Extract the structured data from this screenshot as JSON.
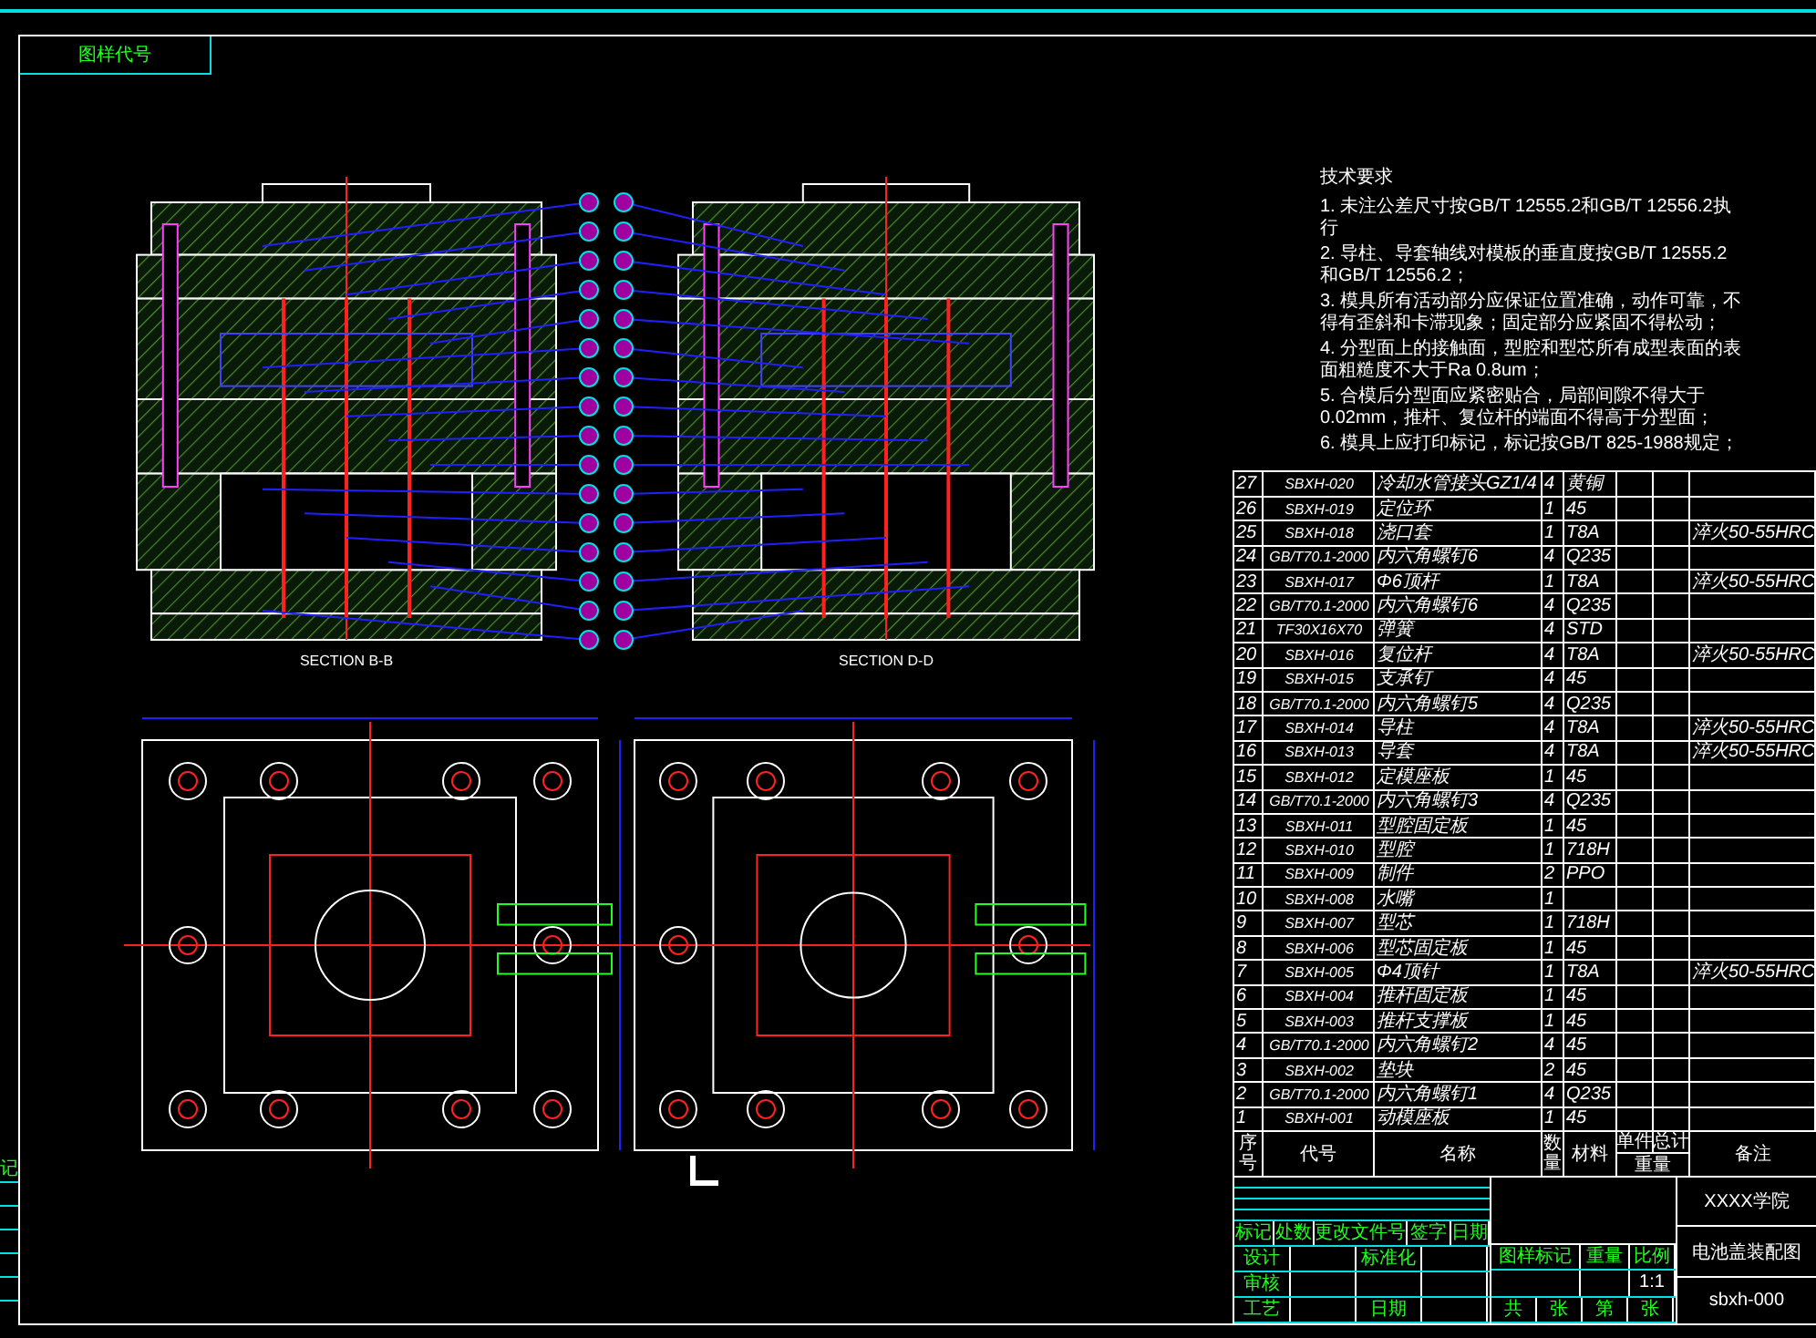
{
  "title_box": {
    "label": "图样代号"
  },
  "side_strip": {
    "label": "记"
  },
  "views": [
    {
      "kind": "section",
      "label": "SECTION B-B"
    },
    {
      "kind": "section",
      "label": "SECTION D-D"
    },
    {
      "kind": "plan"
    },
    {
      "kind": "plan"
    }
  ],
  "notes": {
    "heading": "技术要求",
    "items": [
      "1. 未注公差尺寸按GB/T 12555.2和GB/T 12556.2执行",
      "2. 导柱、导套轴线对模板的垂直度按GB/T 12555.2和GB/T 12556.2；",
      "3. 模具所有活动部分应保证位置准确，动作可靠，不得有歪斜和卡滞现象；固定部分应紧固不得松动；",
      "4. 分型面上的接触面，型腔和型芯所有成型表面的表面粗糙度不大于Ra 0.8um；",
      "5. 合模后分型面应紧密贴合，局部间隙不得大于0.02mm，推杆、复位杆的端面不得高于分型面；",
      "6. 模具上应打印标记，标记按GB/T 825-1988规定；"
    ]
  },
  "parts_table": {
    "rows": [
      {
        "no": "27",
        "code": "SBXH-020",
        "name": "冷却水管接头GZ1/4",
        "qty": "4",
        "material": "黄铜"
      },
      {
        "no": "26",
        "code": "SBXH-019",
        "name": "定位环",
        "qty": "1",
        "material": "45"
      },
      {
        "no": "25",
        "code": "SBXH-018",
        "name": "浇口套",
        "qty": "1",
        "material": "T8A",
        "note": "淬火50-55HRC"
      },
      {
        "no": "24",
        "code": "GB/T70.1-2000",
        "name": "内六角螺钉6",
        "qty": "4",
        "material": "Q235"
      },
      {
        "no": "23",
        "code": "SBXH-017",
        "name": "Φ6顶杆",
        "qty": "1",
        "material": "T8A",
        "note": "淬火50-55HRC"
      },
      {
        "no": "22",
        "code": "GB/T70.1-2000",
        "name": "内六角螺钉6",
        "qty": "4",
        "material": "Q235"
      },
      {
        "no": "21",
        "code": "TF30X16X70",
        "name": "弹簧",
        "qty": "4",
        "material": "STD"
      },
      {
        "no": "20",
        "code": "SBXH-016",
        "name": "复位杆",
        "qty": "4",
        "material": "T8A",
        "note": "淬火50-55HRC"
      },
      {
        "no": "19",
        "code": "SBXH-015",
        "name": "支承钉",
        "qty": "4",
        "material": "45"
      },
      {
        "no": "18",
        "code": "GB/T70.1-2000",
        "name": "内六角螺钉5",
        "qty": "4",
        "material": "Q235"
      },
      {
        "no": "17",
        "code": "SBXH-014",
        "name": "导柱",
        "qty": "4",
        "material": "T8A",
        "note": "淬火50-55HRC"
      },
      {
        "no": "16",
        "code": "SBXH-013",
        "name": "导套",
        "qty": "4",
        "material": "T8A",
        "note": "淬火50-55HRC"
      },
      {
        "no": "15",
        "code": "SBXH-012",
        "name": "定模座板",
        "qty": "1",
        "material": "45"
      },
      {
        "no": "14",
        "code": "GB/T70.1-2000",
        "name": "内六角螺钉3",
        "qty": "4",
        "material": "Q235"
      },
      {
        "no": "13",
        "code": "SBXH-011",
        "name": "型腔固定板",
        "qty": "1",
        "material": "45"
      },
      {
        "no": "12",
        "code": "SBXH-010",
        "name": "型腔",
        "qty": "1",
        "material": "718H"
      },
      {
        "no": "11",
        "code": "SBXH-009",
        "name": "制件",
        "qty": "2",
        "material": "PPO"
      },
      {
        "no": "10",
        "code": "SBXH-008",
        "name": "水嘴",
        "qty": "1"
      },
      {
        "no": "9",
        "code": "SBXH-007",
        "name": "型芯",
        "qty": "1",
        "material": "718H"
      },
      {
        "no": "8",
        "code": "SBXH-006",
        "name": "型芯固定板",
        "qty": "1",
        "material": "45"
      },
      {
        "no": "7",
        "code": "SBXH-005",
        "name": "Φ4顶针",
        "qty": "1",
        "material": "T8A",
        "note": "淬火50-55HRC"
      },
      {
        "no": "6",
        "code": "SBXH-004",
        "name": "推杆固定板",
        "qty": "1",
        "material": "45"
      },
      {
        "no": "5",
        "code": "SBXH-003",
        "name": "推杆支撑板",
        "qty": "1",
        "material": "45"
      },
      {
        "no": "4",
        "code": "GB/T70.1-2000",
        "name": "内六角螺钉2",
        "qty": "4",
        "material": "45"
      },
      {
        "no": "3",
        "code": "SBXH-002",
        "name": "垫块",
        "qty": "2",
        "material": "45"
      },
      {
        "no": "2",
        "code": "GB/T70.1-2000",
        "name": "内六角螺钉1",
        "qty": "4",
        "material": "Q235"
      },
      {
        "no": "1",
        "code": "SBXH-001",
        "name": "动模座板",
        "qty": "1",
        "material": "45"
      }
    ],
    "header": {
      "no": "序号",
      "code": "代号",
      "name": "名称",
      "qty": "数量",
      "material": "材料",
      "single": "单件",
      "total": "总计",
      "weight": "重量",
      "note": "备注"
    }
  },
  "title_block": {
    "revision_labels": [
      "标记",
      "处数",
      "更改文件号",
      "签字",
      "日期"
    ],
    "left_labels": [
      {
        "label": "设计",
        "extra": "标准化"
      },
      {
        "label": "审核"
      },
      {
        "label": "工艺",
        "extra": "日期"
      }
    ],
    "stage_labels": [
      "图样标记",
      "重量",
      "比例"
    ],
    "scale": "1:1",
    "sheet_labels": [
      "共",
      "张",
      "第",
      "张"
    ],
    "school": "XXXX学院",
    "drawing_title": "电池盖装配图",
    "drawing_number": "sbxh-000"
  }
}
